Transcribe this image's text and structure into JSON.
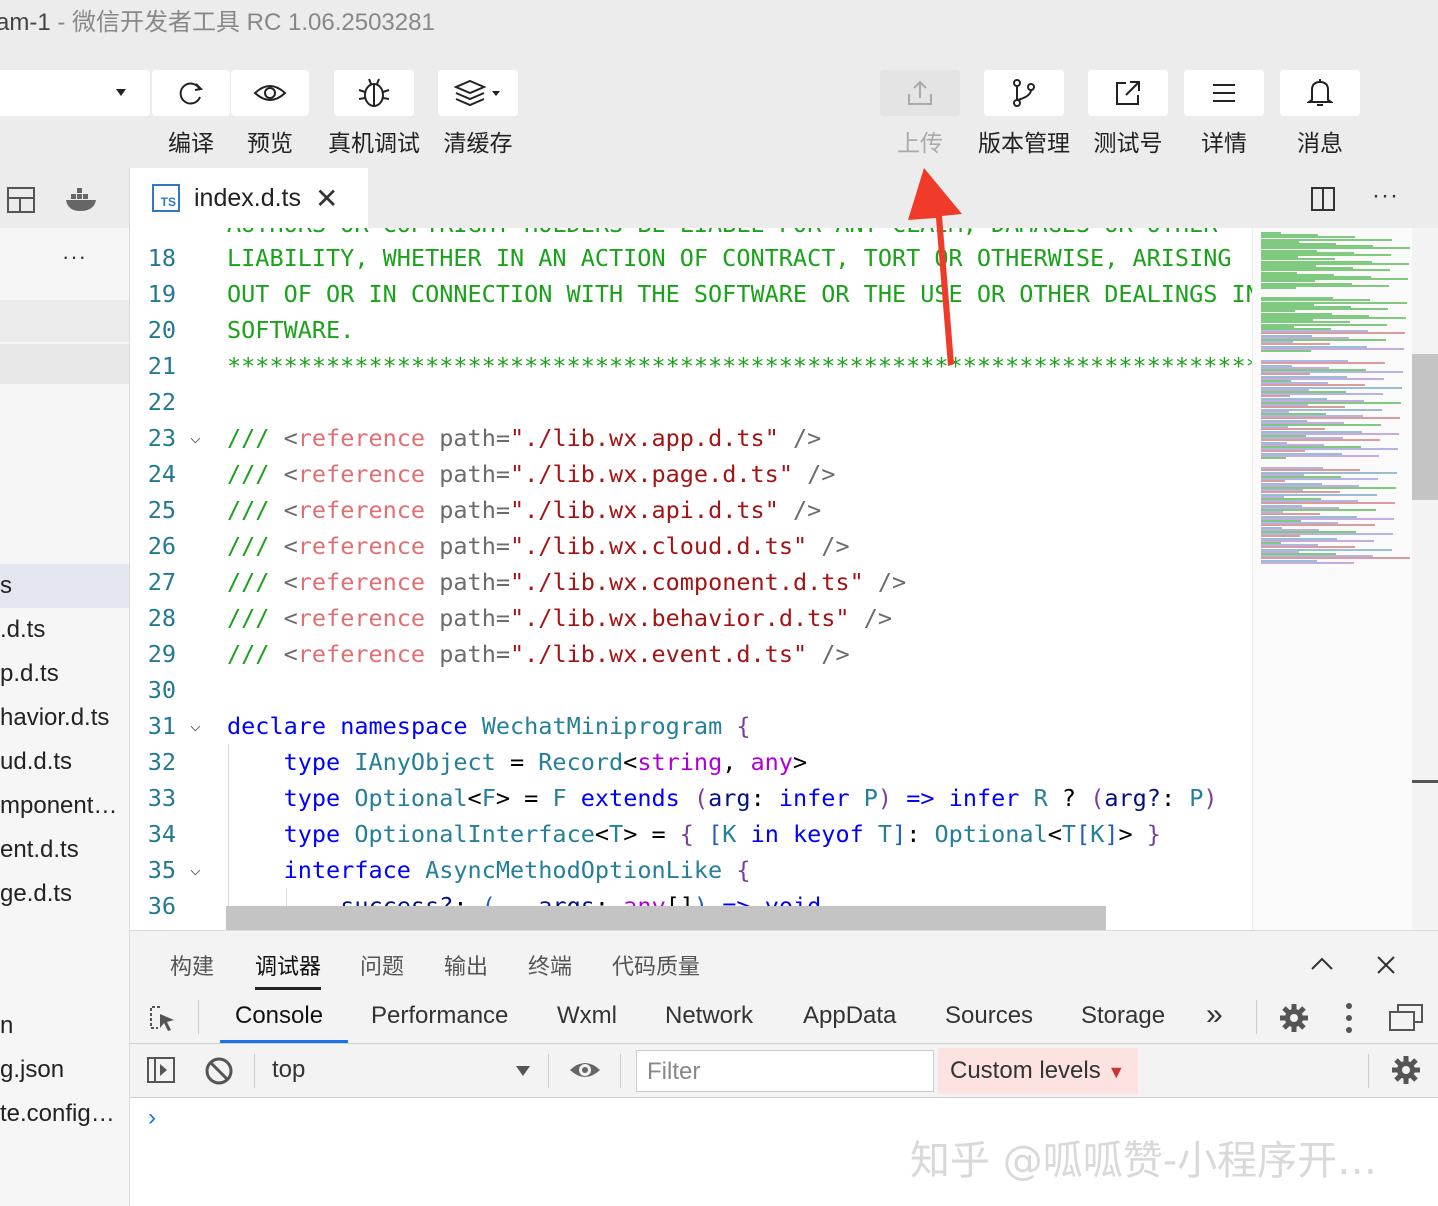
{
  "window": {
    "project_fragment": "am-1",
    "title_suffix": " - 微信开发者工具 RC 1.06.2503281"
  },
  "toolbar": {
    "left_buttons": [
      {
        "label": "编译",
        "icon": "refresh-icon"
      },
      {
        "label": "预览",
        "icon": "eye-icon"
      },
      {
        "label": "真机调试",
        "icon": "bug-icon"
      },
      {
        "label": "清缓存",
        "icon": "layers-icon"
      }
    ],
    "right_buttons": [
      {
        "label": "上传",
        "icon": "upload-icon",
        "disabled": true
      },
      {
        "label": "版本管理",
        "icon": "branch-icon"
      },
      {
        "label": "测试号",
        "icon": "external-link-icon"
      },
      {
        "label": "详情",
        "icon": "menu-icon"
      },
      {
        "label": "消息",
        "icon": "bell-icon"
      }
    ]
  },
  "sidebar": {
    "more": "···",
    "files": [
      "s",
      ".d.ts",
      "p.d.ts",
      "havior.d.ts",
      "ud.d.ts",
      "mponent…",
      "ent.d.ts",
      "ge.d.ts",
      "n",
      "g.json",
      "te.config…"
    ]
  },
  "editor": {
    "tab_name": "index.d.ts",
    "tab_badge": "TS",
    "close": "✕",
    "more": "···",
    "lines": [
      {
        "n": "18",
        "text": "LIABILITY, WHETHER IN AN ACTION OF CONTRACT, TORT OR OTHERWISE, ARISING"
      },
      {
        "n": "19",
        "text": "OUT OF OR IN CONNECTION WITH THE SOFTWARE OR THE USE OR OTHER DEALINGS IN"
      },
      {
        "n": "20",
        "text": "SOFTWARE."
      },
      {
        "n": "21",
        "text": "***************************************************************************"
      },
      {
        "n": "22",
        "text": ""
      },
      {
        "n": "23",
        "ref": "./lib.wx.app.d.ts"
      },
      {
        "n": "24",
        "ref": "./lib.wx.page.d.ts"
      },
      {
        "n": "25",
        "ref": "./lib.wx.api.d.ts"
      },
      {
        "n": "26",
        "ref": "./lib.wx.cloud.d.ts"
      },
      {
        "n": "27",
        "ref": "./lib.wx.component.d.ts"
      },
      {
        "n": "28",
        "ref": "./lib.wx.behavior.d.ts"
      },
      {
        "n": "29",
        "ref": "./lib.wx.event.d.ts"
      },
      {
        "n": "30",
        "text": ""
      },
      {
        "n": "31"
      },
      {
        "n": "32"
      },
      {
        "n": "33"
      },
      {
        "n": "34"
      },
      {
        "n": "35"
      },
      {
        "n": "36"
      }
    ],
    "partial_top_line": "AUTHORS OR COPYRIGHT HOLDERS BE LIABLE FOR ANY CLAIM, DAMAGES OR OTHER"
  },
  "panel": {
    "tabs": [
      "构建",
      "调试器",
      "问题",
      "输出",
      "终端",
      "代码质量"
    ],
    "active_tab": "调试器"
  },
  "devtools": {
    "tabs": [
      "Console",
      "Performance",
      "Wxml",
      "Network",
      "AppData",
      "Sources",
      "Storage"
    ],
    "active_tab": "Console",
    "overflow": "»",
    "context": "top",
    "filter_placeholder": "Filter",
    "levels": "Custom levels",
    "levels_caret": "▼",
    "prompt": "›"
  },
  "watermark": "知乎 @呱呱赞-小程序开…",
  "colors": {
    "comment_green": "#1aa31a",
    "keyword_blue": "#0000ff",
    "annotation_arrow": "#f03a2a",
    "active_tab_underline": "#1a73e8"
  }
}
